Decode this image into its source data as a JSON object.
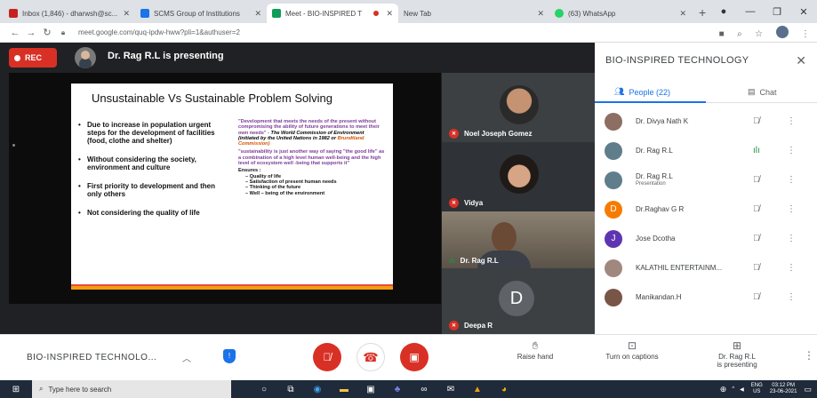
{
  "browser": {
    "tabs": [
      {
        "title": "Inbox (1,846) - dharwsh@sc...",
        "favicon_color": "#c5221f",
        "active": false
      },
      {
        "title": "SCMS Group of Institutions",
        "favicon_color": "#1a73e8",
        "active": false
      },
      {
        "title": "Meet - BIO-INSPIRED T",
        "favicon_color": "#0f9d58",
        "active": true
      },
      {
        "title": "New Tab",
        "favicon_color": "#dadce0",
        "active": false
      },
      {
        "title": "(63) WhatsApp",
        "favicon_color": "#25d366",
        "active": false
      }
    ],
    "new_tab": "+",
    "url": "meet.google.com/quq-ipdw-hww?pli=1&authuser=2",
    "window_controls": [
      "—",
      "❐",
      "✕"
    ]
  },
  "meeting": {
    "rec_label": "REC",
    "presenting_text": "Dr. Rag R.L is presenting"
  },
  "slide": {
    "title": "Unsustainable Vs Sustainable Problem Solving",
    "left_bullets": [
      "Due to increase in population urgent steps for the development of facilities (food, clothe and shelter)",
      "Without considering the society, environment and culture",
      "First priority to development and then only others",
      "Not considering the quality of life"
    ],
    "quote1": "\"Development that meets the needs of the present without compromising the ability of future generations to meet their own needs\" -",
    "quote1_source": "The World Commission of Environment (initiated by the United Nations in 1982 or",
    "quote1_commission": "Brundtland Commission)",
    "quote2": "\"sustainability is just another way of saying \"the good life\" as a combination of a high level human well-being and the high level of ecosystem well -being that supports it\"",
    "ensures_label": "Ensures :",
    "ensures_items": [
      "Quality of life",
      "Satisfaction of present human needs",
      "Thinking of the future",
      "Well – being of the environment"
    ]
  },
  "tiles": [
    {
      "name": "Noel Joseph Gomez",
      "muted": true
    },
    {
      "name": "Vidya",
      "muted": true
    },
    {
      "name": "Dr. Rag R.L",
      "speaking": true
    },
    {
      "name": "Deepa R",
      "letter": "D",
      "muted": true
    }
  ],
  "panel": {
    "title": "BIO-INSPIRED TECHNOLOGY",
    "close": "✕",
    "people_tab": "People (22)",
    "chat_tab": "Chat",
    "participants": [
      {
        "name": "Dr. Divya Nath K",
        "sub": "",
        "status": "muted",
        "avatar_color": "#8d6e63"
      },
      {
        "name": "Dr. Rag R.L",
        "sub": "",
        "status": "speaking",
        "avatar_color": "#607d8b"
      },
      {
        "name": "Dr. Rag R.L",
        "sub": "Presentation",
        "status": "presenting",
        "avatar_color": "#607d8b"
      },
      {
        "name": "Dr.Raghav G R",
        "sub": "",
        "status": "muted",
        "avatar_color": "#f57c00",
        "letter": "D"
      },
      {
        "name": "Jose Dcotha",
        "sub": "",
        "status": "muted",
        "avatar_color": "#5e35b1",
        "letter": "J"
      },
      {
        "name": "KALATHIL ENTERTAINM...",
        "sub": "",
        "status": "muted",
        "avatar_color": "#a1887f"
      },
      {
        "name": "Manikandan.H",
        "sub": "",
        "status": "muted",
        "avatar_color": "#795548"
      }
    ]
  },
  "controls": {
    "meeting_name": "BIO-INSPIRED TECHNOLO...",
    "raise_hand": "Raise hand",
    "captions": "Turn on captions",
    "presenting_line1": "Dr. Rag R.L",
    "presenting_line2": "is presenting"
  },
  "taskbar": {
    "search_placeholder": "Type here to search",
    "lang": "ENG",
    "region": "US",
    "time": "03:12 PM",
    "date": "23-06-2021"
  }
}
